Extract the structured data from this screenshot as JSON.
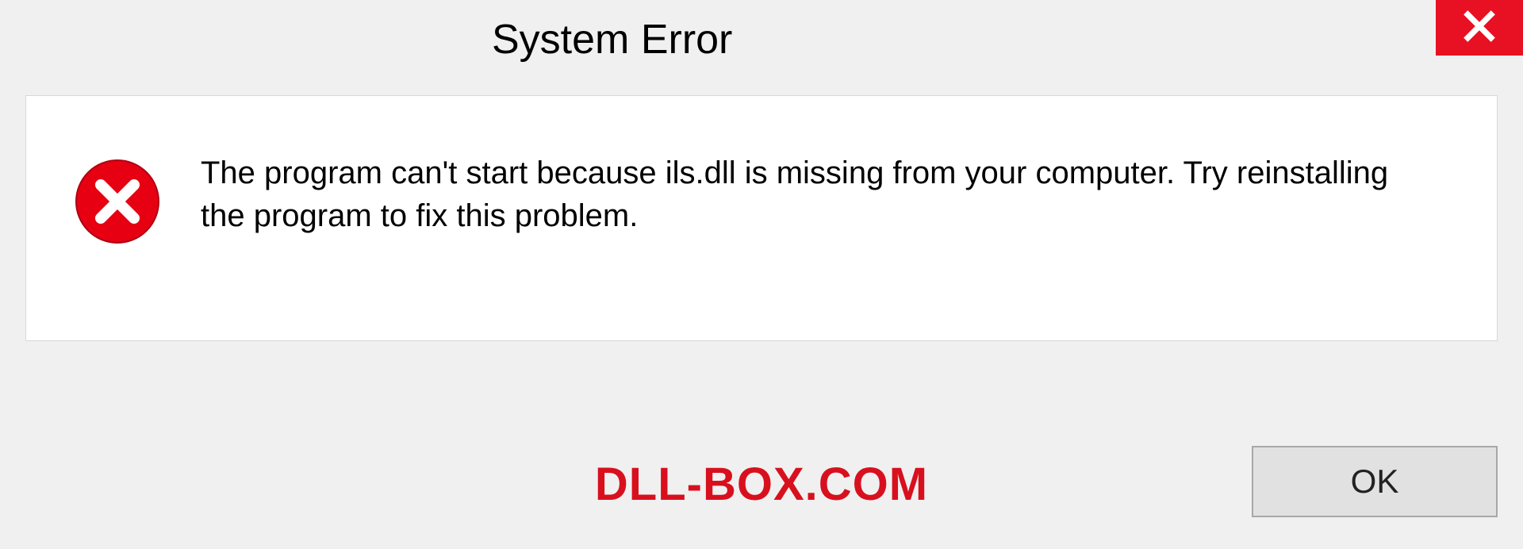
{
  "dialog": {
    "title": "System Error",
    "message": "The program can't start because ils.dll is missing from your computer. Try reinstalling the program to fix this problem.",
    "ok_label": "OK"
  },
  "watermark": "DLL-BOX.COM",
  "colors": {
    "close_bg": "#e81123",
    "error_red": "#d8101e"
  }
}
